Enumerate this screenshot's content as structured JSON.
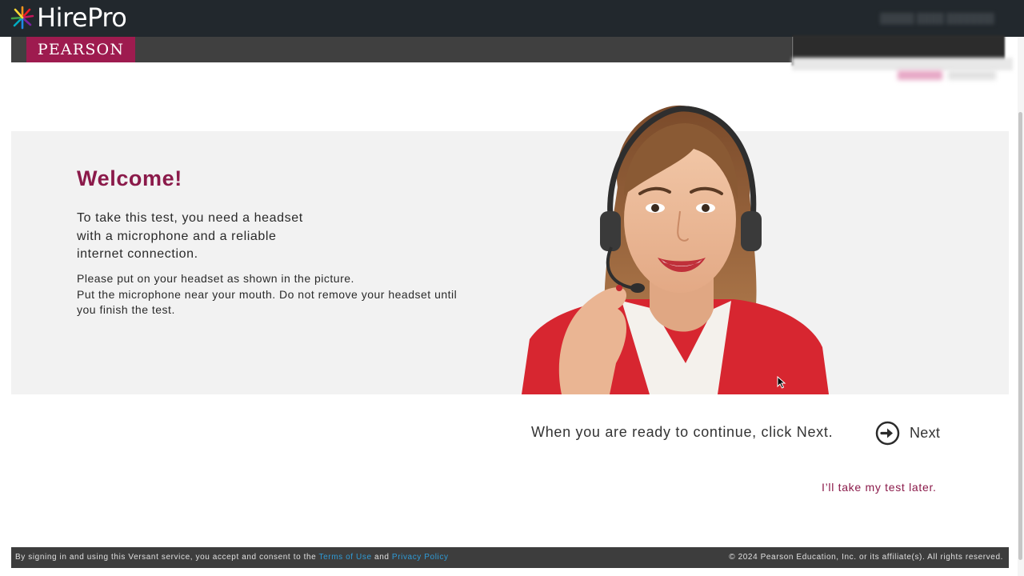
{
  "app": {
    "brand": "HirePro",
    "partner": "PEARSON"
  },
  "main": {
    "welcome_title": "Welcome!",
    "intro_lines": [
      "To take this test, you need a headset",
      "with a microphone and a reliable",
      "internet connection."
    ],
    "instruction_lines": [
      "Please put on your headset as shown in the picture.",
      "Put the microphone near your mouth. Do not remove your headset until",
      "you finish the test."
    ],
    "ready_text": "When you are ready to continue, click Next.",
    "next_label": "Next",
    "later_link": "I’ll take my test later."
  },
  "footer": {
    "consent_prefix": "By signing in and using this Versant service, you accept and consent to the",
    "terms_link": "Terms of Use",
    "and_text": "and",
    "privacy_link": "Privacy Policy",
    "copyright": "© 2024 Pearson Education, Inc. or its affiliate(s). All rights reserved."
  },
  "colors": {
    "topbar": "#22282d",
    "accent": "#8b1a4a",
    "pearson_badge": "#9e1b4f",
    "hero_bg": "#f2f2f2",
    "footer_bg": "#3d3d3d",
    "link": "#2f9bd6"
  },
  "icons": {
    "logo": "starburst-logo-icon",
    "next": "arrow-circle-right-icon",
    "cursor": "mouse-pointer-icon"
  }
}
